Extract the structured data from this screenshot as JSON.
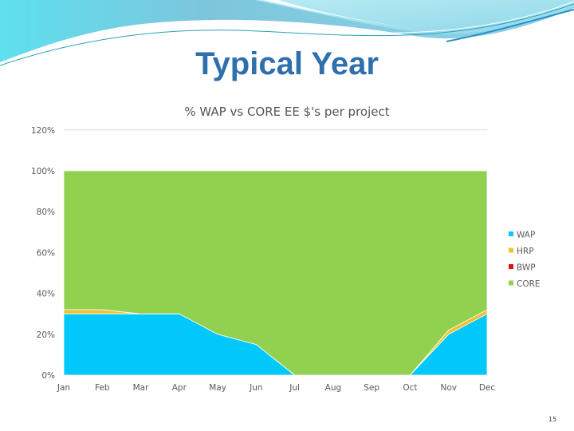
{
  "slide": {
    "title": "Typical Year",
    "page_number": "15"
  },
  "colors": {
    "title": "#2e6fad",
    "WAP": "#00c8fa",
    "HRP": "#f0c030",
    "BWP": "#e01010",
    "CORE": "#92d050"
  },
  "chart_data": {
    "type": "area",
    "stacked": true,
    "title": "% WAP vs CORE EE $'s per project",
    "xlabel": "",
    "ylabel": "",
    "categories": [
      "Jan",
      "Feb",
      "Mar",
      "Apr",
      "May",
      "Jun",
      "Jul",
      "Aug",
      "Sep",
      "Oct",
      "Nov",
      "Dec"
    ],
    "series": [
      {
        "name": "WAP",
        "values": [
          30,
          30,
          30,
          30,
          20,
          15,
          0,
          0,
          0,
          0,
          20,
          30
        ]
      },
      {
        "name": "HRP",
        "values": [
          2,
          2,
          0,
          0,
          0,
          0,
          0,
          0,
          0,
          0,
          2,
          2
        ]
      },
      {
        "name": "BWP",
        "values": [
          0,
          0,
          0,
          0,
          0,
          0,
          0,
          0,
          0,
          0,
          0,
          0
        ]
      },
      {
        "name": "CORE",
        "values": [
          68,
          68,
          70,
          70,
          80,
          85,
          100,
          100,
          100,
          100,
          78,
          68
        ]
      }
    ],
    "ylim": [
      0,
      120
    ],
    "yticks": [
      0,
      20,
      40,
      60,
      80,
      100,
      120
    ],
    "ytick_labels": [
      "0%",
      "20%",
      "40%",
      "60%",
      "80%",
      "100%",
      "120%"
    ],
    "grid": "horizontal",
    "legend": [
      "WAP",
      "HRP",
      "BWP",
      "CORE"
    ],
    "legend_position": "right"
  }
}
